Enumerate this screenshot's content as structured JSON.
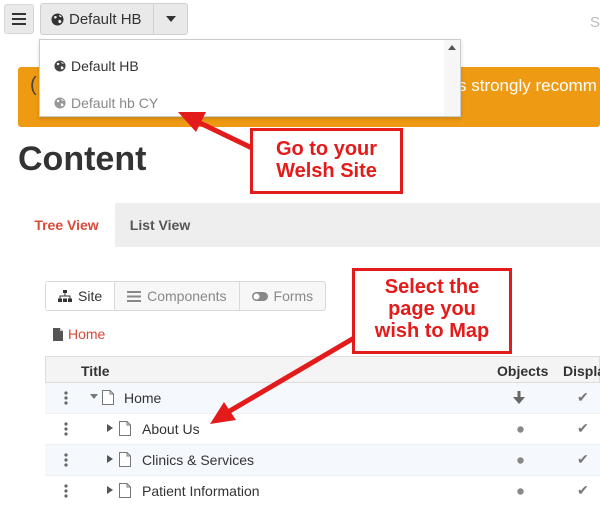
{
  "topbar": {
    "site_label": "Default HB",
    "right_text": "S"
  },
  "dropdown": {
    "items": [
      {
        "label": "Default HB",
        "state": "normal"
      },
      {
        "label": "Default hb CY",
        "state": "muted"
      }
    ]
  },
  "banner": {
    "left_text": "(",
    "text": "s strongly recomm",
    "color": "#ee9a13"
  },
  "page": {
    "title": "Content"
  },
  "tabs": [
    {
      "label": "Tree View",
      "active": true
    },
    {
      "label": "List View",
      "active": false
    }
  ],
  "view_toggle": [
    {
      "label": "Site",
      "icon": "sitemap-icon",
      "active": true
    },
    {
      "label": "Components",
      "icon": "list-icon",
      "active": false
    },
    {
      "label": "Forms",
      "icon": "toggle-icon",
      "active": false
    }
  ],
  "breadcrumb": {
    "label": "Home"
  },
  "table": {
    "columns": [
      "Title",
      "Objects",
      "Displa"
    ],
    "rows": [
      {
        "label": "Home",
        "expanded": true,
        "level": 0,
        "objects": "down-arrow",
        "display": "check"
      },
      {
        "label": "About Us",
        "expanded": false,
        "level": 1,
        "objects": "dot",
        "display": "check"
      },
      {
        "label": "Clinics & Services",
        "expanded": false,
        "level": 1,
        "objects": "dot",
        "display": "check"
      },
      {
        "label": "Patient Information",
        "expanded": false,
        "level": 1,
        "objects": "dot",
        "display": "check"
      }
    ]
  },
  "annotations": [
    {
      "line1": "Go to your",
      "line2": "Welsh Site",
      "color": "#e31b1b"
    },
    {
      "line1": "Select the",
      "line2": "page you",
      "line3": "wish to Map",
      "color": "#e31b1b"
    }
  ],
  "colors": {
    "accent": "#d94a38",
    "annotation": "#e31b1b"
  }
}
